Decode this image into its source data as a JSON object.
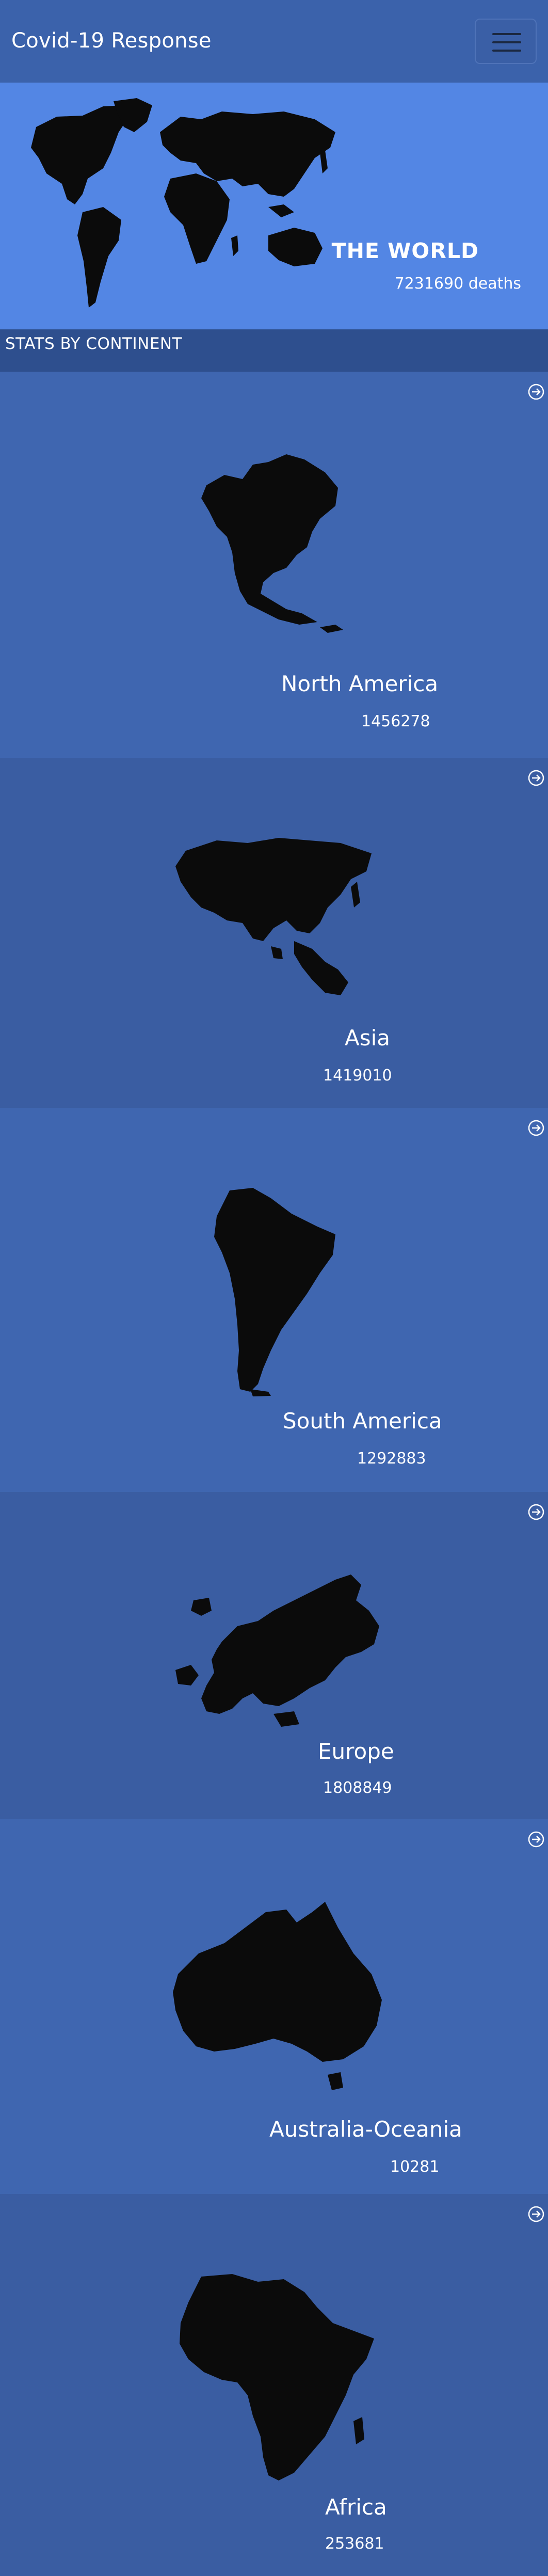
{
  "navbar": {
    "brand": "Covid-19 Response",
    "menu_icon": "hamburger-menu-icon"
  },
  "world": {
    "title": "THE WORLD",
    "deaths_text": "7231690 deaths",
    "map_icon": "world-map-icon"
  },
  "section": {
    "title": "STATS BY CONTINENT"
  },
  "continents": [
    {
      "name": "North America",
      "count": "1456278",
      "map_icon": "north-america-map-icon",
      "link_icon": "arrow-circle-right-icon"
    },
    {
      "name": "Asia",
      "count": "1419010",
      "map_icon": "asia-map-icon",
      "link_icon": "arrow-circle-right-icon"
    },
    {
      "name": "South America",
      "count": "1292883",
      "map_icon": "south-america-map-icon",
      "link_icon": "arrow-circle-right-icon"
    },
    {
      "name": "Europe",
      "count": "1808849",
      "map_icon": "europe-map-icon",
      "link_icon": "arrow-circle-right-icon"
    },
    {
      "name": "Australia-Oceania",
      "count": "10281",
      "map_icon": "australia-map-icon",
      "link_icon": "arrow-circle-right-icon"
    },
    {
      "name": "Africa",
      "count": "253681",
      "map_icon": "africa-map-icon",
      "link_icon": "arrow-circle-right-icon"
    }
  ],
  "colors": {
    "navbar": "#3b62ab",
    "hero": "#5386e4",
    "section_header": "#2e4f8e",
    "card_light": "#3f66b0",
    "card_dark": "#3a5da2",
    "map_fill": "#0b0b0b"
  }
}
